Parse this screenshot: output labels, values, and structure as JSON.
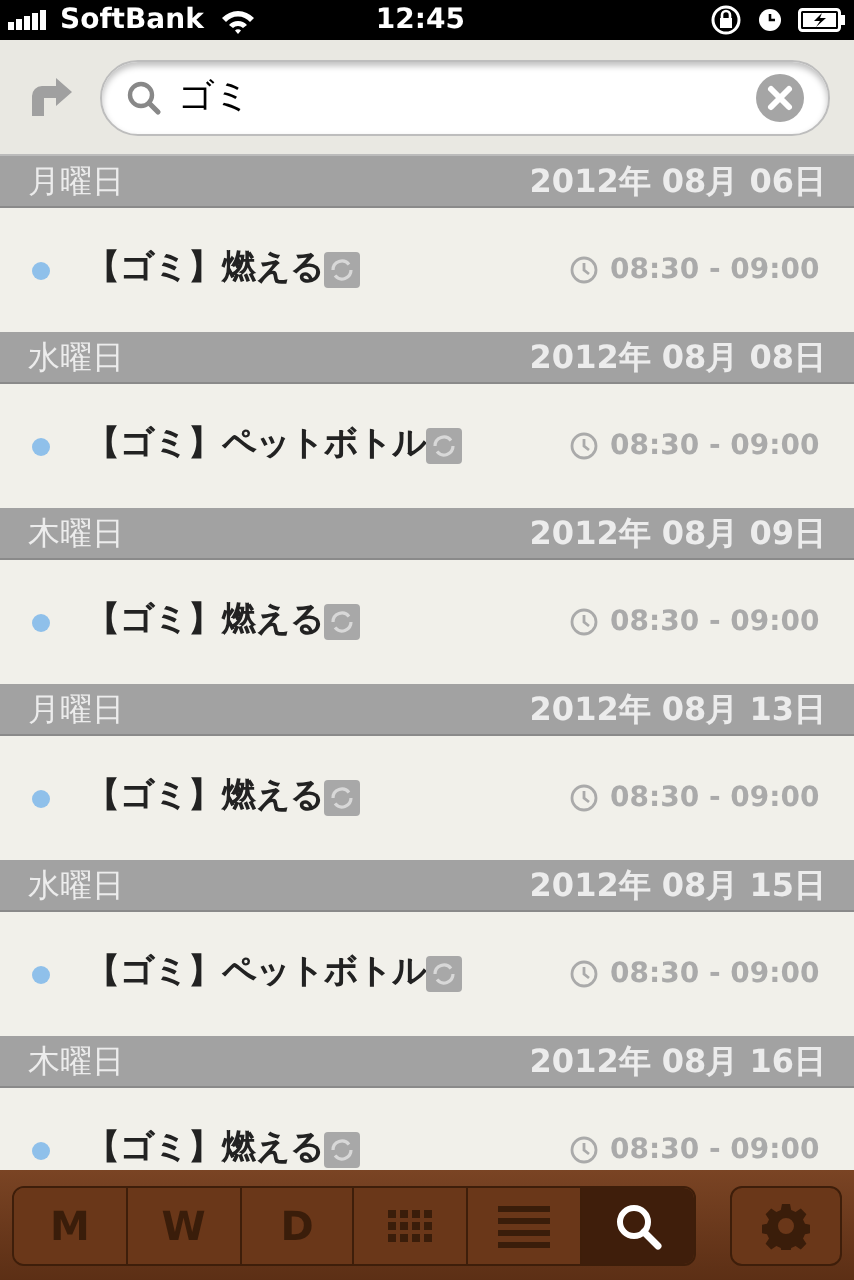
{
  "status_bar": {
    "carrier": "SoftBank",
    "time": "12:45"
  },
  "search": {
    "value": "ゴミ"
  },
  "sections": [
    {
      "weekday": "月曜日",
      "date": "2012年 08月 06日",
      "events": [
        {
          "title": "【ゴミ】燃える",
          "time": "08:30 - 09:00",
          "color": "#8fc0ea"
        }
      ]
    },
    {
      "weekday": "水曜日",
      "date": "2012年 08月 08日",
      "events": [
        {
          "title": "【ゴミ】ペットボトル",
          "time": "08:30 - 09:00",
          "color": "#8fc0ea"
        }
      ]
    },
    {
      "weekday": "木曜日",
      "date": "2012年 08月 09日",
      "events": [
        {
          "title": "【ゴミ】燃える",
          "time": "08:30 - 09:00",
          "color": "#8fc0ea"
        }
      ]
    },
    {
      "weekday": "月曜日",
      "date": "2012年 08月 13日",
      "events": [
        {
          "title": "【ゴミ】燃える",
          "time": "08:30 - 09:00",
          "color": "#8fc0ea"
        }
      ]
    },
    {
      "weekday": "水曜日",
      "date": "2012年 08月 15日",
      "events": [
        {
          "title": "【ゴミ】ペットボトル",
          "time": "08:30 - 09:00",
          "color": "#8fc0ea"
        }
      ]
    },
    {
      "weekday": "木曜日",
      "date": "2012年 08月 16日",
      "events": [
        {
          "title": "【ゴミ】燃える",
          "time": "08:30 - 09:00",
          "color": "#8fc0ea"
        }
      ]
    }
  ],
  "toolbar": [
    {
      "kind": "text",
      "label": "M",
      "selected": false
    },
    {
      "kind": "text",
      "label": "W",
      "selected": false
    },
    {
      "kind": "text",
      "label": "D",
      "selected": false
    },
    {
      "kind": "grid",
      "selected": false
    },
    {
      "kind": "list",
      "selected": false
    },
    {
      "kind": "search",
      "selected": true
    }
  ]
}
